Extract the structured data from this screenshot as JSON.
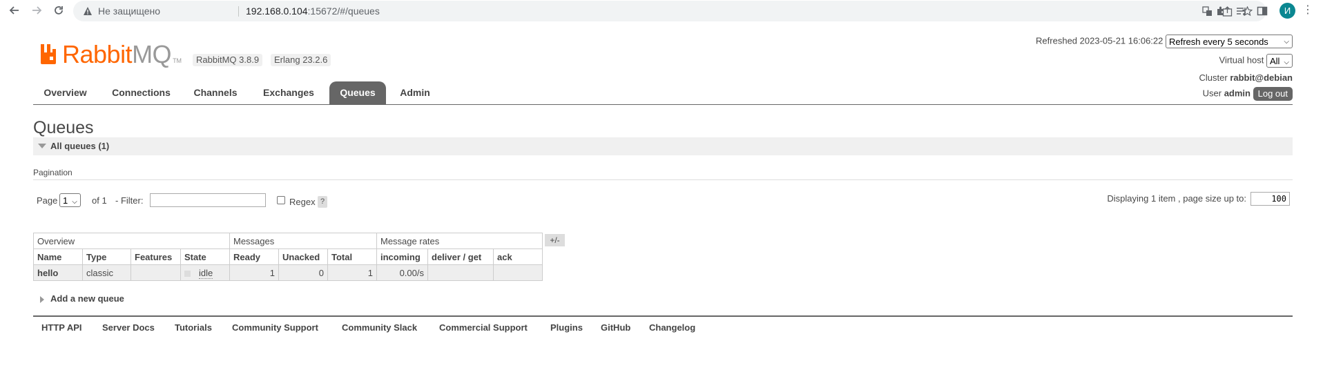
{
  "browser": {
    "insecure_label": "Не защищено",
    "url_host": "192.168.0.104",
    "url_path": ":15672/#/queues",
    "avatar_letter": "И"
  },
  "app": {
    "logo_text_rabbit": "Rabbit",
    "logo_text_mq": "MQ",
    "logo_tm": "TM",
    "version": "RabbitMQ 3.8.9",
    "erlang": "Erlang 23.2.6",
    "brand_color": "#ff6600"
  },
  "tabs": [
    {
      "label": "Overview"
    },
    {
      "label": "Connections"
    },
    {
      "label": "Channels"
    },
    {
      "label": "Exchanges"
    },
    {
      "label": "Queues",
      "active": true
    },
    {
      "label": "Admin"
    }
  ],
  "header": {
    "refreshed_label": "Refreshed",
    "refreshed_time": "2023-05-21 16:06:22",
    "refresh_select": "Refresh every 5 seconds",
    "vhost_label": "Virtual host",
    "vhost_select": "All",
    "cluster_label": "Cluster",
    "cluster_name": "rabbit@debian",
    "user_label": "User",
    "user_name": "admin",
    "logout_label": "Log out"
  },
  "page": {
    "title": "Queues",
    "section_label": "All queues (1)",
    "pagination_label": "Pagination"
  },
  "pagination": {
    "page_label": "Page",
    "page_select": "1",
    "of_label": "of 1",
    "filter_label": "- Filter:",
    "filter_value": "",
    "regex_label": "Regex",
    "help_label": "?",
    "display_info": "Displaying 1 item , page size up to:",
    "page_size": "100"
  },
  "table": {
    "groups": [
      "Overview",
      "Messages",
      "Message rates"
    ],
    "toggle_label": "+/-",
    "columns": [
      "Name",
      "Type",
      "Features",
      "State",
      "Ready",
      "Unacked",
      "Total",
      "incoming",
      "deliver / get",
      "ack"
    ],
    "rows": [
      {
        "name": "hello",
        "type": "classic",
        "features": "",
        "state": "idle",
        "ready": "1",
        "unacked": "0",
        "total": "1",
        "incoming": "0.00/s",
        "deliver_get": "",
        "ack": ""
      }
    ]
  },
  "add_queue_label": "Add a new queue",
  "footer": [
    {
      "label": "HTTP API"
    },
    {
      "label": "Server Docs"
    },
    {
      "label": "Tutorials"
    },
    {
      "label": "Community Support"
    },
    {
      "label": "Community Slack"
    },
    {
      "label": "Commercial Support"
    },
    {
      "label": "Plugins"
    },
    {
      "label": "GitHub"
    },
    {
      "label": "Changelog"
    }
  ]
}
